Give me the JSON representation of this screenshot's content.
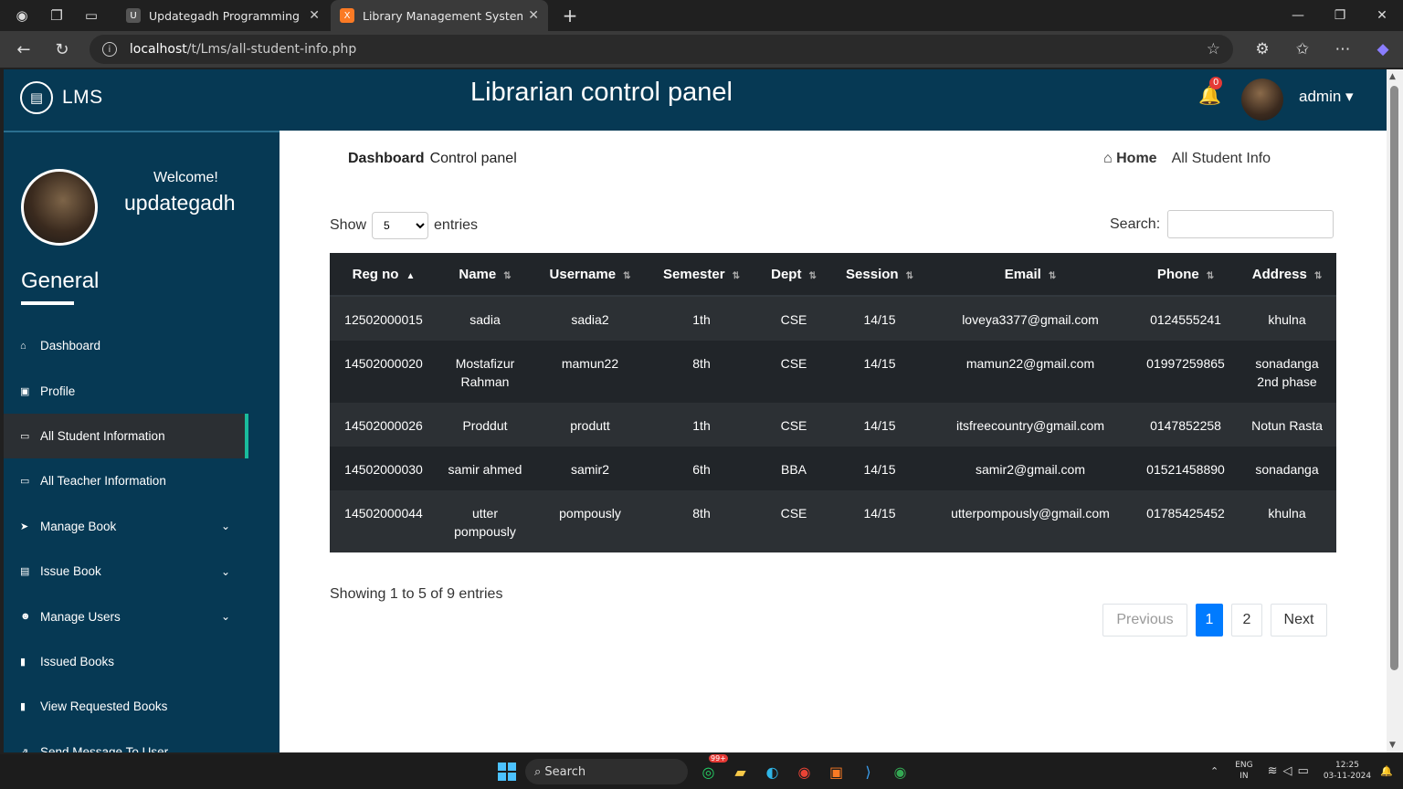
{
  "browser": {
    "tabs": [
      {
        "title": "Updategadh Programming - Upd",
        "active": false
      },
      {
        "title": "Library Management System",
        "active": true
      }
    ],
    "url_host": "localhost",
    "url_path": "/t/Lms/all-student-info.php"
  },
  "header": {
    "logo_text": "LMS",
    "title": "Librarian control panel",
    "notification_count": "0",
    "admin_label": "admin ▾"
  },
  "sidebar": {
    "welcome": "Welcome!",
    "username": "updategadh",
    "section": "General",
    "items": [
      {
        "label": "Dashboard",
        "icon": "home-icon",
        "expandable": false
      },
      {
        "label": "Profile",
        "icon": "id-card-icon",
        "expandable": false
      },
      {
        "label": "All Student Information",
        "icon": "monitor-icon",
        "expandable": false,
        "active": true
      },
      {
        "label": "All Teacher Information",
        "icon": "monitor-icon",
        "expandable": false
      },
      {
        "label": "Manage Book",
        "icon": "send-icon",
        "expandable": true
      },
      {
        "label": "Issue Book",
        "icon": "list-icon",
        "expandable": true
      },
      {
        "label": "Manage Users",
        "icon": "users-icon",
        "expandable": true
      },
      {
        "label": "Issued Books",
        "icon": "bookmark-icon",
        "expandable": false
      },
      {
        "label": "View Requested Books",
        "icon": "book-icon",
        "expandable": false
      },
      {
        "label": "Send Message To User",
        "icon": "share-icon",
        "expandable": true
      }
    ]
  },
  "breadcrumb": {
    "title": "Dashboard",
    "subtitle": "Control panel",
    "home": "Home",
    "current": "All Student Info"
  },
  "table_controls": {
    "show_label": "Show",
    "entries_value": "5",
    "entries_label": "entries",
    "search_label": "Search:"
  },
  "table": {
    "headers": [
      "Reg no",
      "Name",
      "Username",
      "Semester",
      "Dept",
      "Session",
      "Email",
      "Phone",
      "Address"
    ],
    "rows": [
      [
        "12502000015",
        "sadia",
        "sadia2",
        "1th",
        "CSE",
        "14/15",
        "loveya3377@gmail.com",
        "0124555241",
        "khulna"
      ],
      [
        "14502000020",
        "Mostafizur Rahman",
        "mamun22",
        "8th",
        "CSE",
        "14/15",
        "mamun22@gmail.com",
        "01997259865",
        "sonadanga 2nd phase"
      ],
      [
        "14502000026",
        "Proddut",
        "produtt",
        "1th",
        "CSE",
        "14/15",
        "itsfreecountry@gmail.com",
        "0147852258",
        "Notun Rasta"
      ],
      [
        "14502000030",
        "samir ahmed",
        "samir2",
        "6th",
        "BBA",
        "14/15",
        "samir2@gmail.com",
        "01521458890",
        "sonadanga"
      ],
      [
        "14502000044",
        "utter pompously",
        "pompously",
        "8th",
        "CSE",
        "14/15",
        "utterpompously@gmail.com",
        "01785425452",
        "khulna"
      ]
    ]
  },
  "footer": {
    "showing": "Showing 1 to 5 of 9 entries",
    "previous": "Previous",
    "page1": "1",
    "page2": "2",
    "next": "Next"
  },
  "taskbar": {
    "search": "Search",
    "whatsapp_badge": "99+",
    "lang_line1": "ENG",
    "lang_line2": "IN",
    "time": "12:25",
    "date": "03-11-2024"
  }
}
